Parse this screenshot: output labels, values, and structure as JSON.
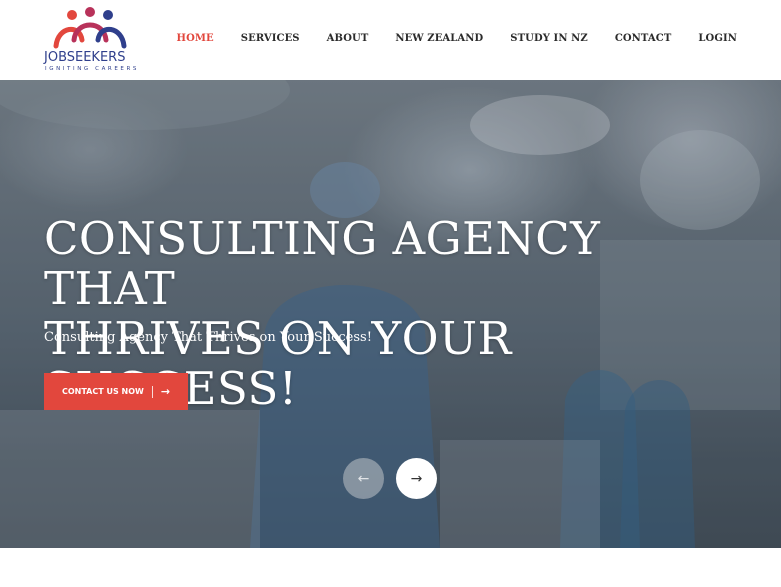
{
  "logo": {
    "word": "JOBSEEKERS",
    "tagline": "IGNITING CAREERS",
    "colors": {
      "left": "#e2473d",
      "middle": "#b8325a",
      "right": "#2f3f8c"
    }
  },
  "nav": {
    "items": [
      {
        "label": "HOME",
        "active": true
      },
      {
        "label": "SERVICES"
      },
      {
        "label": "ABOUT"
      },
      {
        "label": "NEW ZEALAND"
      },
      {
        "label": "STUDY IN NZ"
      },
      {
        "label": "CONTACT"
      },
      {
        "label": "LOGIN"
      }
    ]
  },
  "hero": {
    "title_line1": "CONSULTING AGENCY THAT",
    "title_line2": "THRIVES ON YOUR SUCCESS!",
    "subtitle": "Consulting Agency That Thrives on Your Success!",
    "cta_label": "CONTACT US NOW",
    "cta_icon": "arrow-right-icon",
    "prev_icon": "arrow-left-icon",
    "next_icon": "arrow-right-icon",
    "prev_glyph": "←",
    "next_glyph": "→",
    "cta_glyph": "→"
  },
  "colors": {
    "accent": "#e2473d",
    "nav_text": "#2b2b2b",
    "brand_blue": "#2f3f8c"
  }
}
